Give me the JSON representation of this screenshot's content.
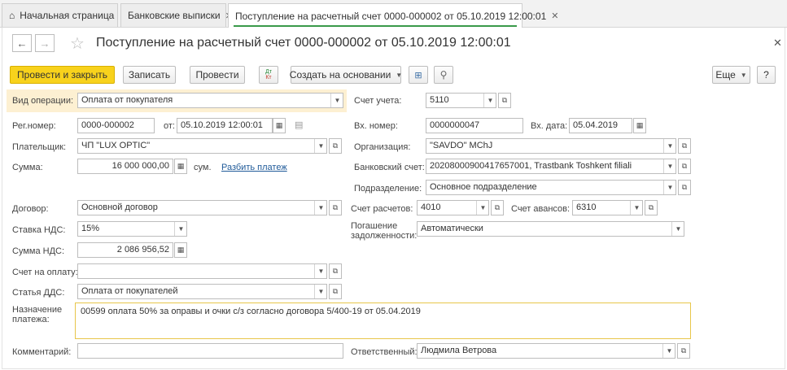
{
  "tabs": [
    {
      "label": "Начальная страница"
    },
    {
      "label": "Банковские выписки"
    },
    {
      "label": "Поступление на расчетный счет 0000-000002 от 05.10.2019 12:00:01"
    }
  ],
  "header": {
    "title": "Поступление на расчетный счет 0000-000002 от 05.10.2019 12:00:01"
  },
  "toolbar": {
    "post_close": "Провести и закрыть",
    "save": "Записать",
    "post": "Провести",
    "dtkt": "Дт Кт",
    "create_based": "Создать на основании",
    "more": "Еще",
    "help": "?"
  },
  "form": {
    "op_type_label": "Вид операции:",
    "op_type_value": "Оплата от покупателя",
    "account_label": "Счет учета:",
    "account_value": "5110",
    "regnum_label": "Рег.номер:",
    "regnum_value": "0000-000002",
    "from_label": "от:",
    "from_value": "05.10.2019 12:00:01",
    "inc_num_label": "Вх. номер:",
    "inc_num_value": "0000000047",
    "inc_date_label": "Вх. дата:",
    "inc_date_value": "05.04.2019",
    "payer_label": "Плательщик:",
    "payer_value": "ЧП \"LUX OPTIC\"",
    "org_label": "Организация:",
    "org_value": "\"SAVDO\" MChJ",
    "sum_label": "Сумма:",
    "sum_value": "16 000 000,00",
    "sum_currency": "сум.",
    "split_payment": "Разбить платеж",
    "bank_acc_label": "Банковский счет:",
    "bank_acc_value": "20208000900417657001, Trastbank Toshkent filiali",
    "division_label": "Подразделение:",
    "division_value": "Основное подразделение",
    "contract_label": "Договор:",
    "contract_value": "Основной договор",
    "settle_acc_label": "Счет расчетов:",
    "settle_acc_value": "4010",
    "adv_acc_label": "Счет авансов:",
    "adv_acc_value": "6310",
    "vat_rate_label": "Ставка НДС:",
    "vat_rate_value": "15%",
    "repay_label_1": "Погашение",
    "repay_label_2": "задолженности:",
    "repay_value": "Автоматически",
    "vat_sum_label": "Сумма НДС:",
    "vat_sum_value": "2 086 956,52",
    "invoice_label": "Счет на оплату:",
    "invoice_value": "",
    "cashflow_label": "Статья ДДС:",
    "cashflow_value": "Оплата от покупателей",
    "purpose_label_1": "Назначение",
    "purpose_label_2": "платежа:",
    "purpose_value": "00599 оплата 50% за оправы и очки с/з согласно договора 5/400-19 от 05.04.2019",
    "comment_label": "Комментарий:",
    "comment_value": "",
    "responsible_label": "Ответственный:",
    "responsible_value": "Людмила Ветрова"
  }
}
